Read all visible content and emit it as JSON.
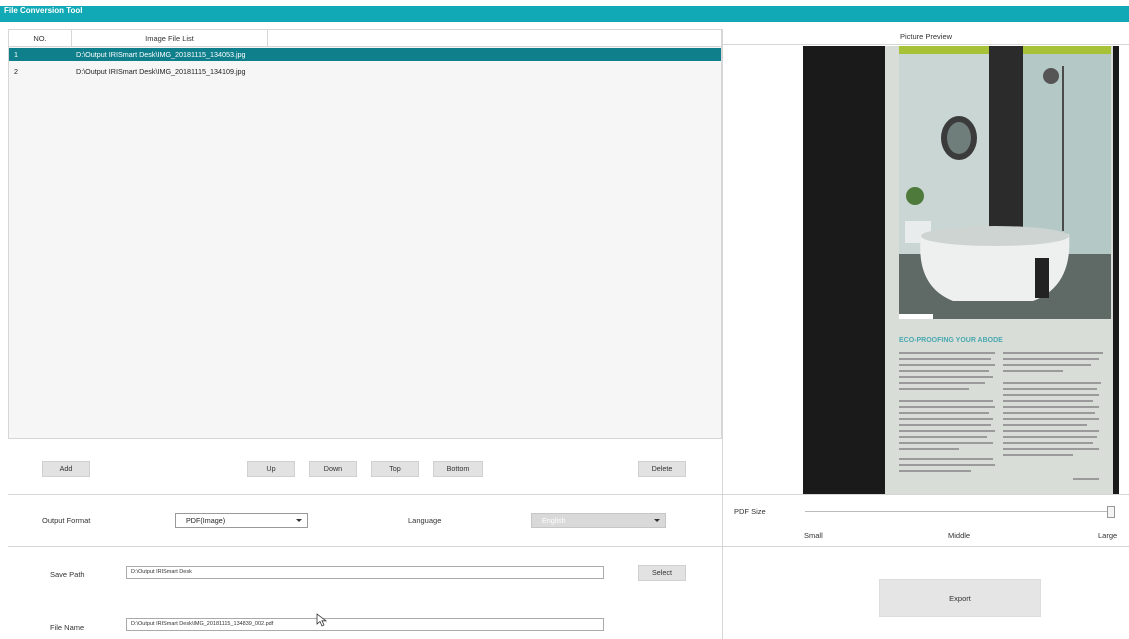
{
  "app": {
    "title": "File Conversion Tool"
  },
  "file_list": {
    "headers": {
      "no": "NO.",
      "file": "Image File List"
    },
    "rows": [
      {
        "no": "1",
        "file": "D:\\Output IRISmart Desk\\IMG_20181115_134053.jpg",
        "selected": true
      },
      {
        "no": "2",
        "file": "D:\\Output IRISmart Desk\\IMG_20181115_134109.jpg",
        "selected": false
      }
    ]
  },
  "buttons": {
    "add": "Add",
    "up": "Up",
    "down": "Down",
    "top": "Top",
    "bottom": "Bottom",
    "delete": "Delete",
    "select": "Select",
    "export": "Export"
  },
  "output": {
    "format_label": "Output Format",
    "format_value": "PDF(Image)",
    "language_label": "Language",
    "language_value": "English"
  },
  "pdf_size": {
    "label": "PDF Size",
    "small": "Small",
    "middle": "Middle",
    "large": "Large",
    "value_fraction": 1.0
  },
  "save": {
    "path_label": "Save Path",
    "path_value": "D:\\Output IRISmart Desk",
    "name_label": "File Name",
    "name_value": "D:\\Output IRISmart Desk\\IMG_20181115_134839_002.pdf"
  },
  "preview": {
    "title": "Picture Preview",
    "heading": "ECO-PROOFING YOUR ABODE"
  },
  "colors": {
    "accent": "#11a9b5",
    "selection": "#0f7f8c",
    "panel": "#f6f6f6"
  }
}
